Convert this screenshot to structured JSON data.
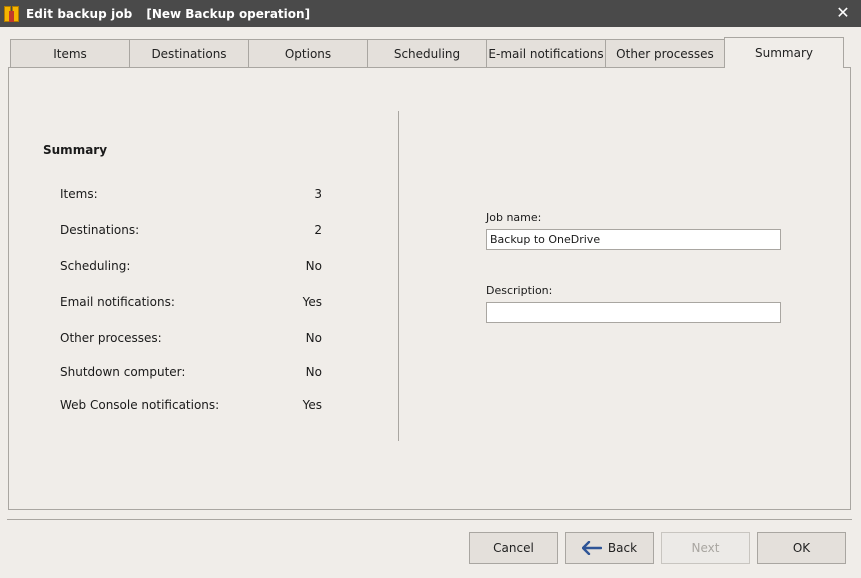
{
  "window": {
    "title": "Edit backup job",
    "subtitle": "[New Backup operation]",
    "close_glyph": "✕"
  },
  "tabs": [
    {
      "label": "Items"
    },
    {
      "label": "Destinations"
    },
    {
      "label": "Options"
    },
    {
      "label": "Scheduling"
    },
    {
      "label": "E-mail notifications"
    },
    {
      "label": "Other processes"
    },
    {
      "label": "Summary",
      "active": true
    }
  ],
  "summary": {
    "heading": "Summary",
    "rows": [
      {
        "label": "Items:",
        "value": "3"
      },
      {
        "label": "Destinations:",
        "value": "2"
      },
      {
        "label": "Scheduling:",
        "value": "No"
      },
      {
        "label": "Email notifications:",
        "value": "Yes"
      },
      {
        "label": "Other processes:",
        "value": "No"
      },
      {
        "label": "Shutdown computer:",
        "value": "No"
      },
      {
        "label": "Web Console notifications:",
        "value": "Yes"
      }
    ]
  },
  "form": {
    "job_name_label": "Job name:",
    "job_name_value": "Backup to OneDrive",
    "description_label": "Description:",
    "description_value": ""
  },
  "buttons": {
    "cancel": "Cancel",
    "back": "Back",
    "next": "Next",
    "ok": "OK"
  },
  "colors": {
    "titlebar": "#4a4a4a",
    "background": "#f0ede9",
    "accent_arrow": "#2f5597"
  }
}
